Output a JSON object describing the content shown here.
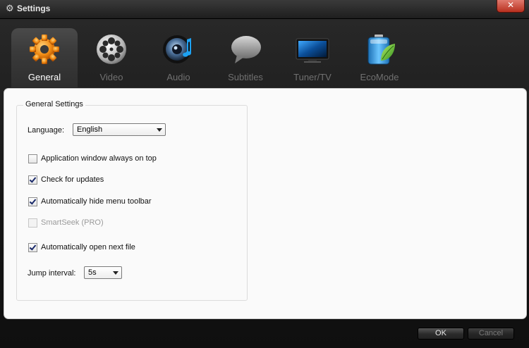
{
  "window": {
    "title": "Settings",
    "close_label": "✕"
  },
  "tabs": [
    {
      "label": "General",
      "icon": "gear-icon",
      "active": true
    },
    {
      "label": "Video",
      "icon": "film-reel-icon",
      "active": false
    },
    {
      "label": "Audio",
      "icon": "speaker-icon",
      "active": false
    },
    {
      "label": "Subtitles",
      "icon": "speech-bubble-icon",
      "active": false
    },
    {
      "label": "Tuner/TV",
      "icon": "tv-icon",
      "active": false
    },
    {
      "label": "EcoMode",
      "icon": "battery-leaf-icon",
      "active": false
    }
  ],
  "general": {
    "group_title": "General Settings",
    "language_label": "Language:",
    "language_value": "English",
    "options": [
      {
        "label": "Application window always on top",
        "checked": false,
        "disabled": false
      },
      {
        "label": "Check for updates",
        "checked": true,
        "disabled": false
      },
      {
        "label": "Automatically hide menu toolbar",
        "checked": true,
        "disabled": false
      },
      {
        "label": "SmartSeek (PRO)",
        "checked": false,
        "disabled": true
      },
      {
        "label": "Automatically open next file",
        "checked": true,
        "disabled": false
      }
    ],
    "jump_label": "Jump interval:",
    "jump_value": "5s"
  },
  "footer": {
    "ok_label": "OK",
    "cancel_label": "Cancel"
  },
  "colors": {
    "accent_active_text": "#ffffff",
    "inactive_text": "#707070",
    "close_red": "#c0392b"
  }
}
